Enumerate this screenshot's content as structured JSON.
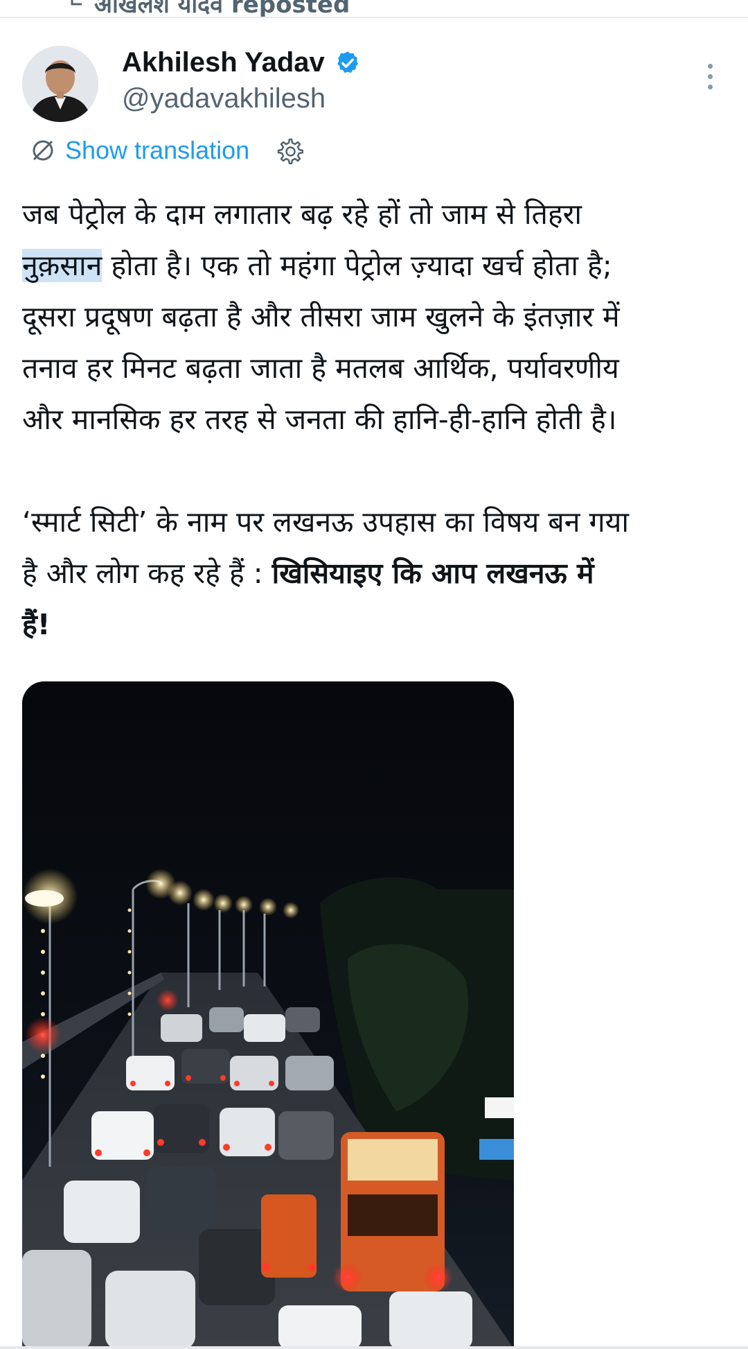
{
  "repost": {
    "label": "अखिलेश यादव reposted"
  },
  "author": {
    "name": "Akhilesh Yadav",
    "handle": "@yadavakhilesh",
    "verified": true
  },
  "translation": {
    "label": "Show translation"
  },
  "tweet": {
    "line1": "जब पेट्रोल के दाम लगातार बढ़ रहे हों तो जाम से तिहरा",
    "highlight_word": "नुक़सान",
    "line2_rest": " होता है। एक तो महंगा पेट्रोल ज़्यादा खर्च होता है;",
    "line3": "दूसरा प्रदूषण बढ़ता है और तीसरा जाम खुलने के इंतज़ार में",
    "line4": "तनाव हर मिनट बढ़ता जाता है मतलब आर्थिक, पर्यावरणीय",
    "line5": "और मानसिक हर तरह से जनता की हानि-ही-हानि होती है।",
    "para2_a": "‘स्मार्ट सिटी’ के नाम पर लखनऊ उपहास का विषय बन गया",
    "para2_b": "है और लोग कह रहे हैं : ",
    "para2_bold_a": "खिसियाइए कि आप लखनऊ में",
    "para2_bold_b": "हैं!"
  },
  "media": {
    "type": "video-thumbnail",
    "description_icon": "night-traffic-jam-image"
  },
  "colors": {
    "accent": "#1d9bf0",
    "text": "#0f1419",
    "secondary": "#536471",
    "highlight": "#cfe3f7"
  }
}
